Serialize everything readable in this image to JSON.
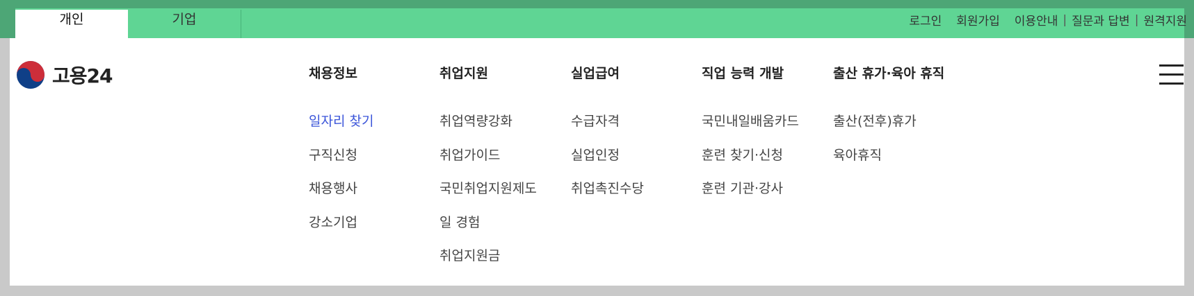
{
  "top_tabs": {
    "personal": "개인",
    "corporate": "기업"
  },
  "utility_links": {
    "login": "로그인",
    "signup": "회원가입",
    "usage_guide": "이용안내",
    "qna": "질문과 답변",
    "remote_support": "원격지원",
    "separator": "|"
  },
  "logo": {
    "text": "고용24",
    "icon": "taegeuk-icon",
    "colors": {
      "red": "#cd2e3a",
      "blue": "#0f3f87",
      "text": "#222222"
    }
  },
  "nav": {
    "columns": [
      {
        "title": "채용정보",
        "items": [
          "일자리 찾기",
          "구직신청",
          "채용행사",
          "강소기업"
        ],
        "active_index": 0
      },
      {
        "title": "취업지원",
        "items": [
          "취업역량강화",
          "취업가이드",
          "국민취업지원제도",
          "일 경험",
          "취업지원금"
        ]
      },
      {
        "title": "실업급여",
        "items": [
          "수급자격",
          "실업인정",
          "취업촉진수당"
        ]
      },
      {
        "title": "직업 능력 개발",
        "items": [
          "국민내일배움카드",
          "훈련 찾기·신청",
          "훈련 기관·강사"
        ]
      },
      {
        "title": "출산 휴가·육아 휴직",
        "items": [
          "출산(전후)휴가",
          "육아휴직"
        ]
      }
    ]
  },
  "menu": {
    "icon": "hamburger-menu-icon"
  },
  "colors": {
    "top_bar": "#5fd594",
    "top_bar_dark": "#4da676",
    "active_link": "#3b55d9",
    "background": "#ffffff"
  }
}
